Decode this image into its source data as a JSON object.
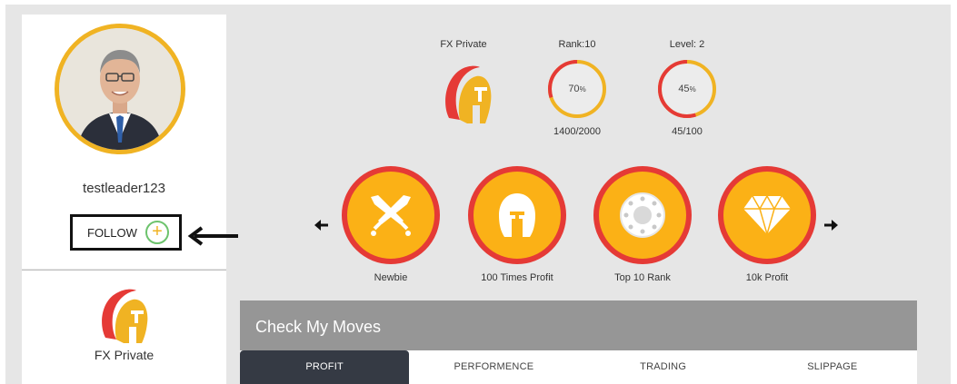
{
  "profile": {
    "username": "testleader123",
    "follow_label": "FOLLOW",
    "follow_plus": "+",
    "avatar_ring_color": "#f0b323"
  },
  "brand": {
    "name": "FX Private",
    "logo_icon": "spartan-helmet-icon"
  },
  "header": {
    "brand_name": "FX Private",
    "rank": {
      "label": "Rank:10",
      "percent_text": "70",
      "percent_sign": "%",
      "value": 0.7,
      "progress": "1400/2000"
    },
    "level": {
      "label": "Level: 2",
      "percent_text": "45",
      "percent_sign": "%",
      "value": 0.45,
      "progress": "45/100"
    }
  },
  "badges": [
    {
      "label": "Newbie",
      "icon": "crossed-swords-icon"
    },
    {
      "label": "100 Times Profit",
      "icon": "helmet-icon"
    },
    {
      "label": "Top 10 Rank",
      "icon": "shield-icon"
    },
    {
      "label": "10k Profit",
      "icon": "diamond-icon"
    }
  ],
  "moves": {
    "title": "Check My Moves",
    "tabs": [
      {
        "label": "PROFIT",
        "active": true
      },
      {
        "label": "PERFORMENCE",
        "active": false
      },
      {
        "label": "TRADING",
        "active": false
      },
      {
        "label": "SLIPPAGE",
        "active": false
      }
    ]
  },
  "colors": {
    "accent_orange": "#f0b323",
    "accent_red": "#e53a36",
    "badge_fill": "#fbb116",
    "tab_active": "#353a44",
    "panel_bg": "#e6e6e6"
  }
}
